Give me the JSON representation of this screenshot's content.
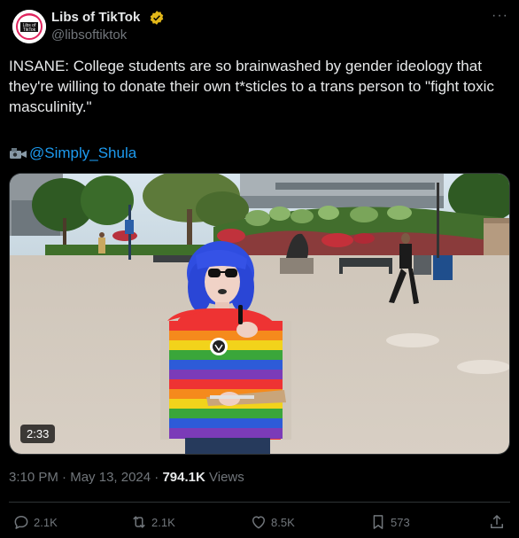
{
  "author": {
    "display_name": "Libs of TikTok",
    "handle": "@libsoftiktok",
    "verified": true,
    "avatar_text": "Libs of TikTok"
  },
  "more_label": "···",
  "tweet": {
    "text": "INSANE: College students are so brainwashed by gender ideology that they're willing to donate their own t*sticles to a trans person to \"fight toxic masculinity.\"",
    "mention": "@Simply_Shula"
  },
  "video": {
    "duration": "2:33"
  },
  "meta": {
    "time": "3:10 PM",
    "separator": " · ",
    "date": "May 13, 2024",
    "views_count": "794.1K",
    "views_label": " Views"
  },
  "actions": {
    "reply_count": "2.1K",
    "repost_count": "2.1K",
    "like_count": "8.5K",
    "bookmark_count": "573"
  },
  "colors": {
    "background": "#000000",
    "text": "#e7e9ea",
    "secondary": "#71767b",
    "accent": "#1d9bf0",
    "verified": "#e2b719"
  },
  "icons": [
    "verified-badge-icon",
    "more-icon",
    "camera-icon",
    "reply-icon",
    "repost-icon",
    "like-icon",
    "bookmark-icon",
    "share-icon"
  ]
}
